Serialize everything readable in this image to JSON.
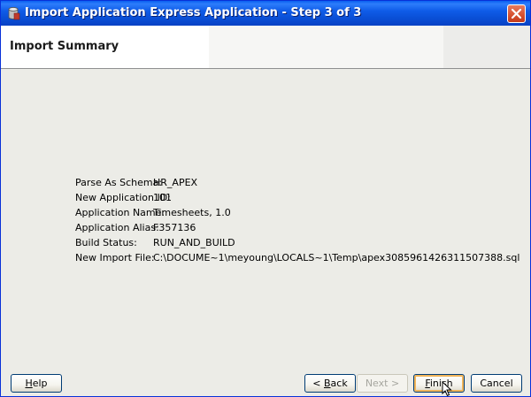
{
  "window": {
    "title": "Import Application Express Application - Step 3 of 3"
  },
  "header": {
    "title": "Import Summary"
  },
  "summary": {
    "rows": [
      {
        "label": "Parse As Schema:",
        "value": "HR_APEX"
      },
      {
        "label": "New Application ID:",
        "value": "101"
      },
      {
        "label": "Application Name:",
        "value": "Timesheets, 1.0"
      },
      {
        "label": "Application Alias:",
        "value": "F357136"
      },
      {
        "label": "Build Status:",
        "value": "RUN_AND_BUILD"
      },
      {
        "label": "New Import File:",
        "value": "C:\\DOCUME~1\\meyoung\\LOCALS~1\\Temp\\apex3085961426311507388.sql"
      }
    ]
  },
  "buttons": {
    "help": {
      "mnemonic": "H",
      "rest": "elp"
    },
    "back": {
      "prefix": "< ",
      "mnemonic": "B",
      "rest": "ack"
    },
    "next": {
      "label": "Next >"
    },
    "finish": {
      "mnemonic": "F",
      "rest": "inish"
    },
    "cancel": {
      "label": "Cancel"
    }
  },
  "colors": {
    "titlebar": "#0a4fd6",
    "close": "#d6502e",
    "window_bg": "#ecece7"
  }
}
